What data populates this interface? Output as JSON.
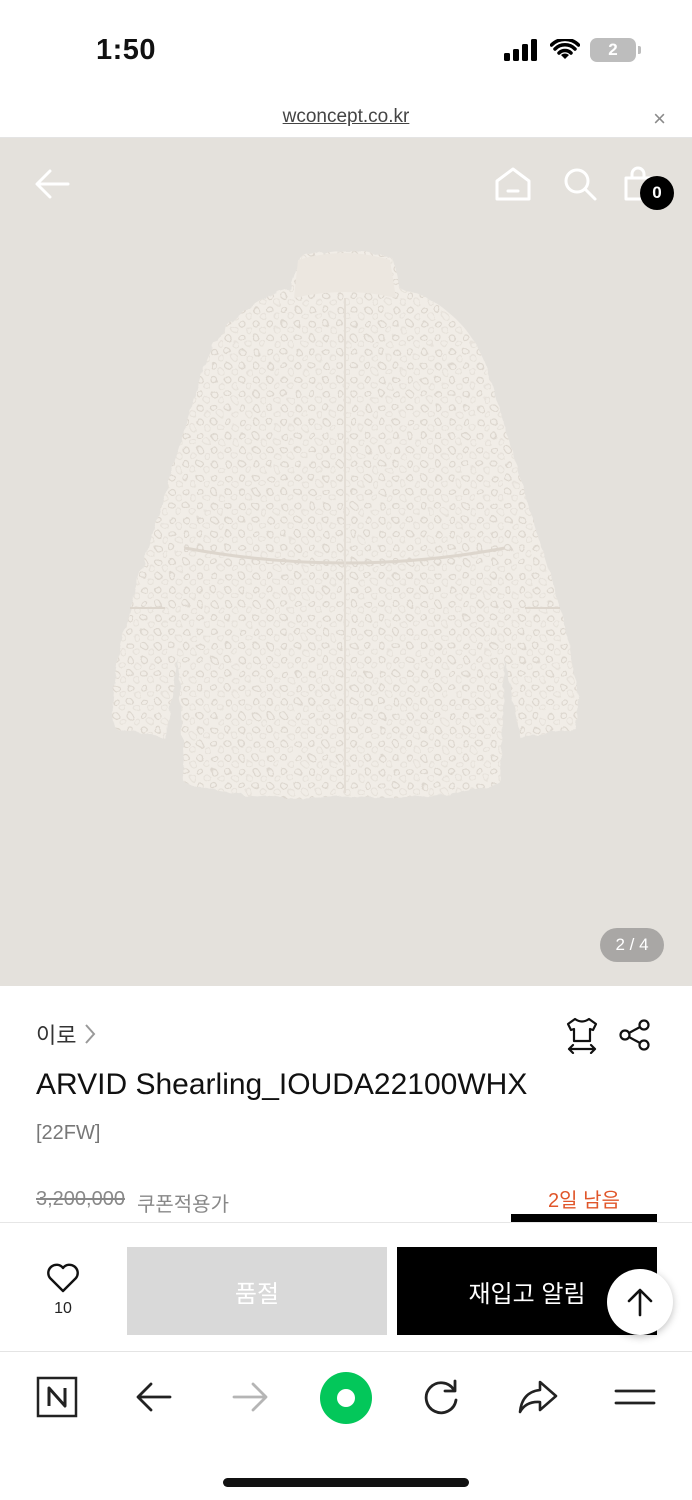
{
  "status": {
    "time": "1:50",
    "battery": "2"
  },
  "browser": {
    "url": "wconcept.co.kr",
    "close": "×"
  },
  "hero": {
    "slide_indicator": "2 / 4",
    "cart_count": "0"
  },
  "product": {
    "brand": "이로",
    "title": "ARVID Shearling_IOUDA22100WHX",
    "season": "[22FW]",
    "original_price": "3,200,000",
    "price_label": "쿠폰적용가",
    "days_left": "2일 남음"
  },
  "actions": {
    "wish_count": "10",
    "soldout_label": "품절",
    "restock_label": "재입고 알림"
  },
  "colors": {
    "accent": "#e0562a",
    "naver_green": "#03c75a"
  }
}
